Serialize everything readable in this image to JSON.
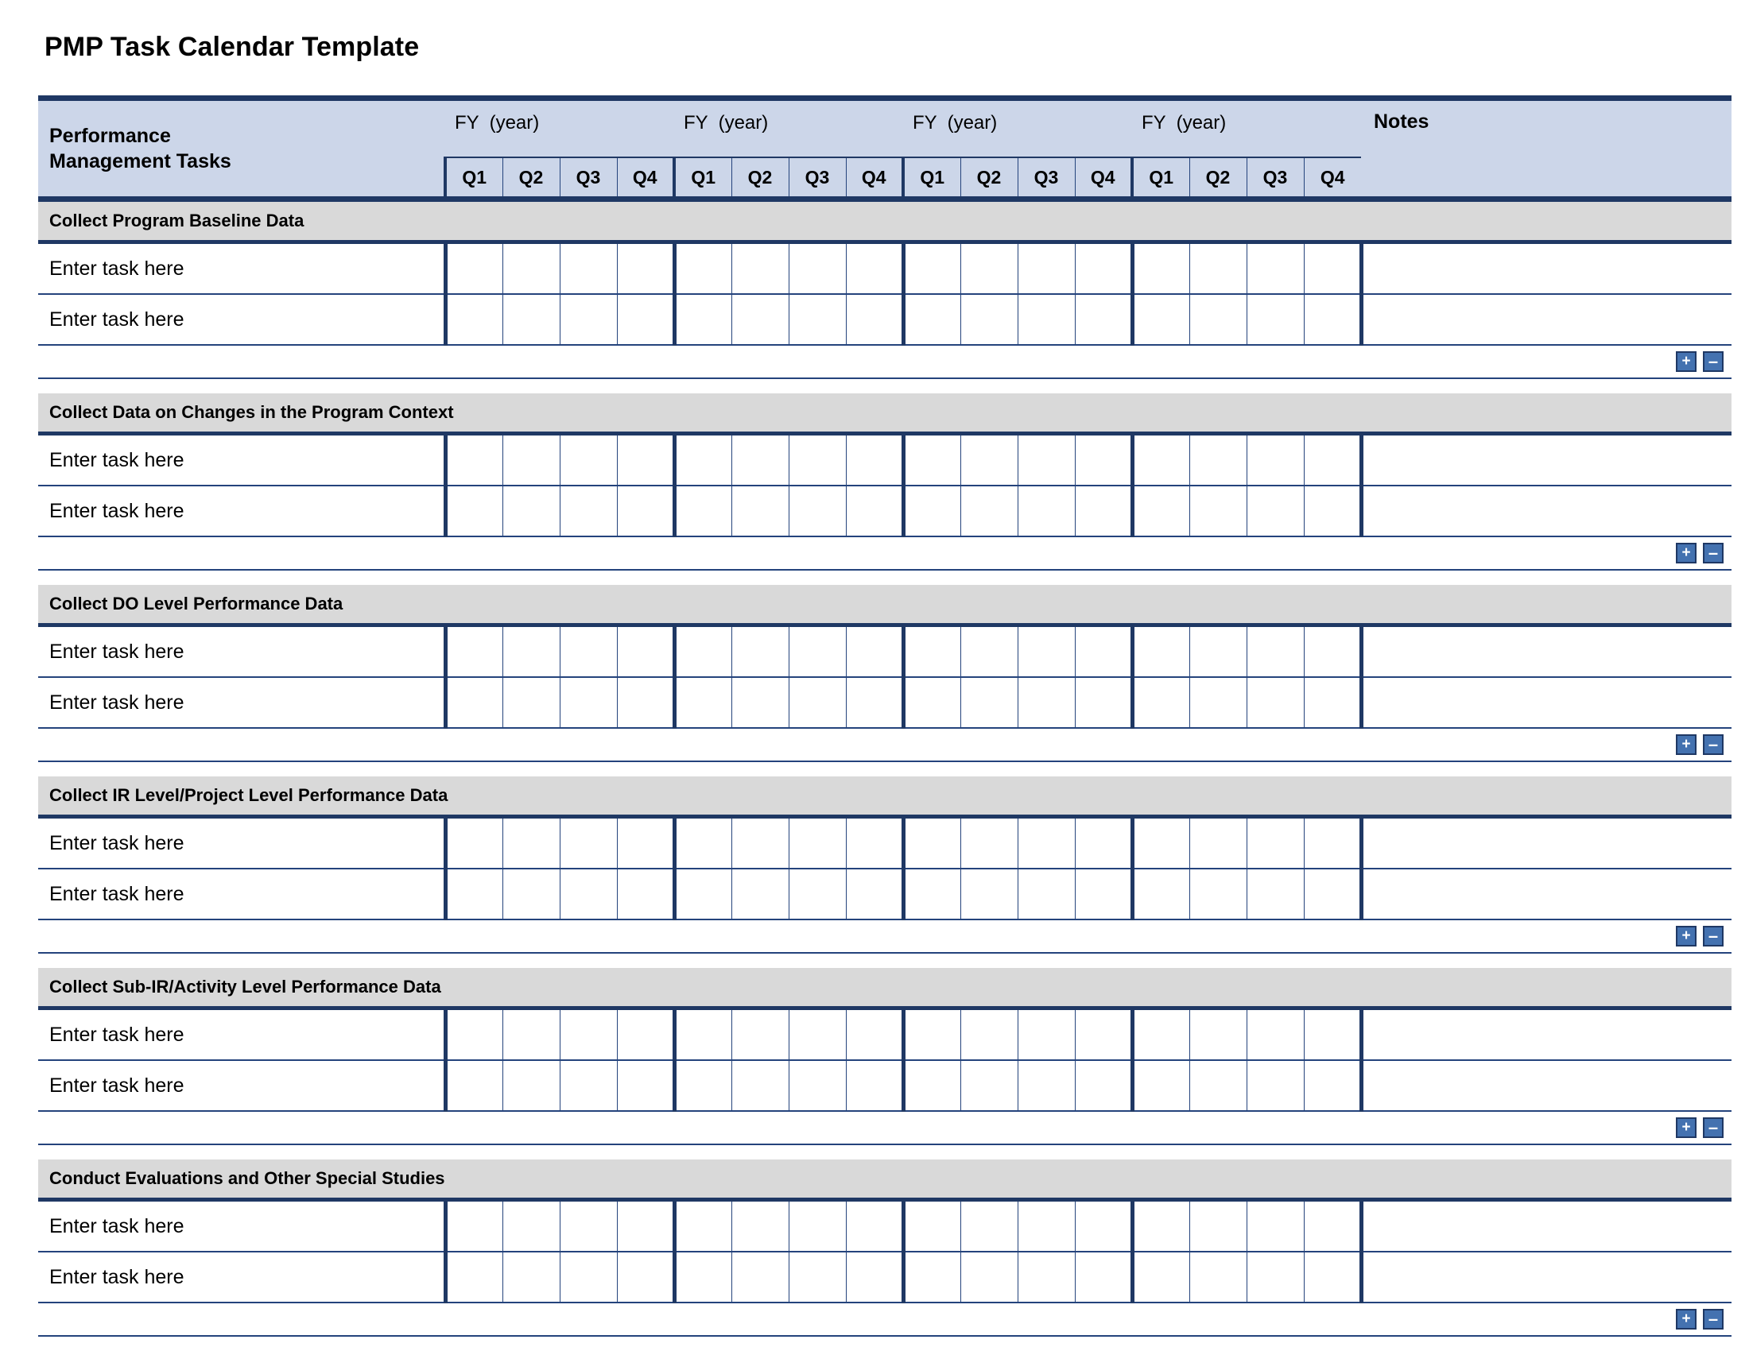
{
  "document": {
    "title": "PMP Task Calendar Template"
  },
  "table": {
    "task_column_header": "Performance\nManagement Tasks",
    "notes_column_header": "Notes",
    "fiscal_years": [
      {
        "label": "FY  (year)",
        "quarters": [
          "Q1",
          "Q2",
          "Q3",
          "Q4"
        ]
      },
      {
        "label": "FY  (year)",
        "quarters": [
          "Q1",
          "Q2",
          "Q3",
          "Q4"
        ]
      },
      {
        "label": "FY  (year)",
        "quarters": [
          "Q1",
          "Q2",
          "Q3",
          "Q4"
        ]
      },
      {
        "label": "FY  (year)",
        "quarters": [
          "Q1",
          "Q2",
          "Q3",
          "Q4"
        ]
      }
    ],
    "task_placeholder": "Enter task here",
    "add_row_label": "+",
    "remove_row_label": "–",
    "sections": [
      {
        "title": "Collect Program Baseline Data",
        "tasks": [
          "Enter task here",
          "Enter task here"
        ]
      },
      {
        "title": "Collect Data on Changes in the Program Context",
        "tasks": [
          "Enter task here",
          "Enter task here"
        ]
      },
      {
        "title": "Collect DO Level Performance Data",
        "tasks": [
          "Enter task here",
          "Enter task here"
        ]
      },
      {
        "title": "Collect IR Level/Project Level Performance Data",
        "tasks": [
          "Enter task here",
          "Enter task here"
        ]
      },
      {
        "title": "Collect Sub-IR/Activity Level Performance Data",
        "tasks": [
          "Enter task here",
          "Enter task here"
        ]
      },
      {
        "title": "Conduct Evaluations and Other Special Studies",
        "tasks": [
          "Enter task here",
          "Enter task here"
        ]
      }
    ]
  },
  "colors": {
    "header_fill": "#ccd6e9",
    "section_fill": "#d9d9d9",
    "rule_dark": "#1f3864",
    "grid_line": "#24437c",
    "button_fill": "#4472b0",
    "page_background": "#ffffff"
  }
}
